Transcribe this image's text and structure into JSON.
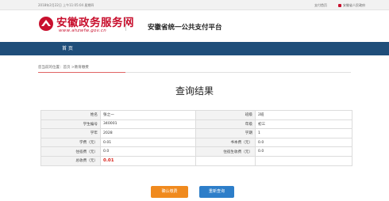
{
  "topbar": {
    "datetime": "2018年2月22日 上午11:05:04 星期四",
    "link_pay": "支付首页",
    "link_user": "安徽省人民政府"
  },
  "header": {
    "logo_title": "安徽政务服务网",
    "logo_url": "www.ahzwfw.gov.cn",
    "platform": "安徽省统一公共支付平台"
  },
  "nav": {
    "home": "首 页"
  },
  "breadcrumb": {
    "text": "您当前的位置：首页 >教育缴费"
  },
  "page": {
    "title": "查询结果"
  },
  "result": {
    "rows": [
      [
        "姓名",
        "张之一",
        "班级",
        "2班"
      ],
      [
        "学生编号",
        "340001",
        "年级",
        "初三"
      ],
      [
        "学年",
        "2028",
        "学期",
        "1"
      ],
      [
        "学费（元）",
        "0.01",
        "书本费（元）",
        "0.0"
      ],
      [
        "住宿费（元）",
        "0.0",
        "住宿生收费（元）",
        "0.0"
      ]
    ],
    "total_label": "总收费（元）",
    "total_value": "0.01"
  },
  "buttons": {
    "confirm": "确认缴费",
    "requery": "重新查询"
  },
  "colors": {
    "nav_bg": "#1f4e7a",
    "brand_red": "#c8102e",
    "confirm_btn": "#f08a1e",
    "requery_btn": "#2d7ec9"
  }
}
